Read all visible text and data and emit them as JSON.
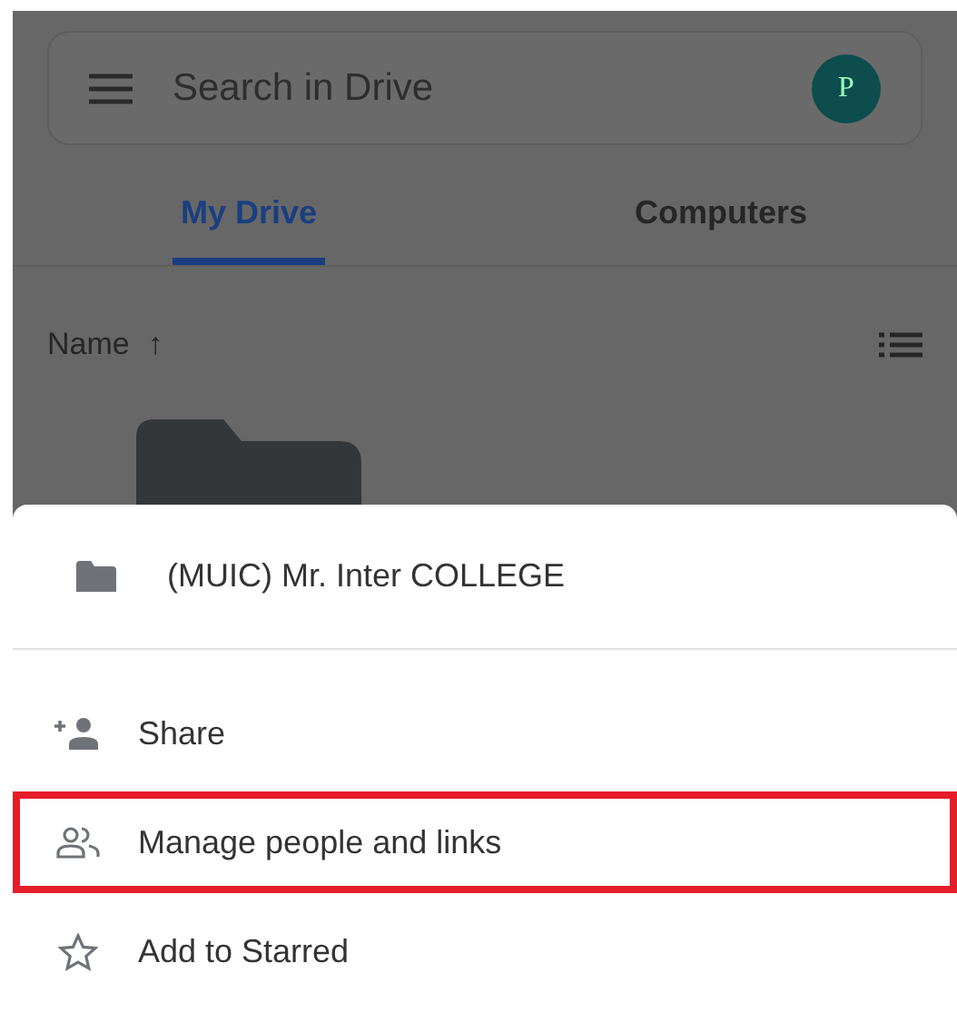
{
  "search": {
    "placeholder": "Search in Drive",
    "avatar": "P"
  },
  "tabs": [
    {
      "label": "My Drive",
      "selected": true
    },
    {
      "label": "Computers",
      "selected": false
    }
  ],
  "sort": {
    "label": "Name",
    "arrow": "↑"
  },
  "sheet": {
    "title": "(MUIC) Mr. Inter COLLEGE",
    "items": [
      {
        "kind": "share",
        "label": "Share",
        "highlighted": false
      },
      {
        "kind": "manage",
        "label": "Manage people and links",
        "highlighted": true
      },
      {
        "kind": "star",
        "label": "Add to Starred",
        "highlighted": false
      }
    ]
  }
}
